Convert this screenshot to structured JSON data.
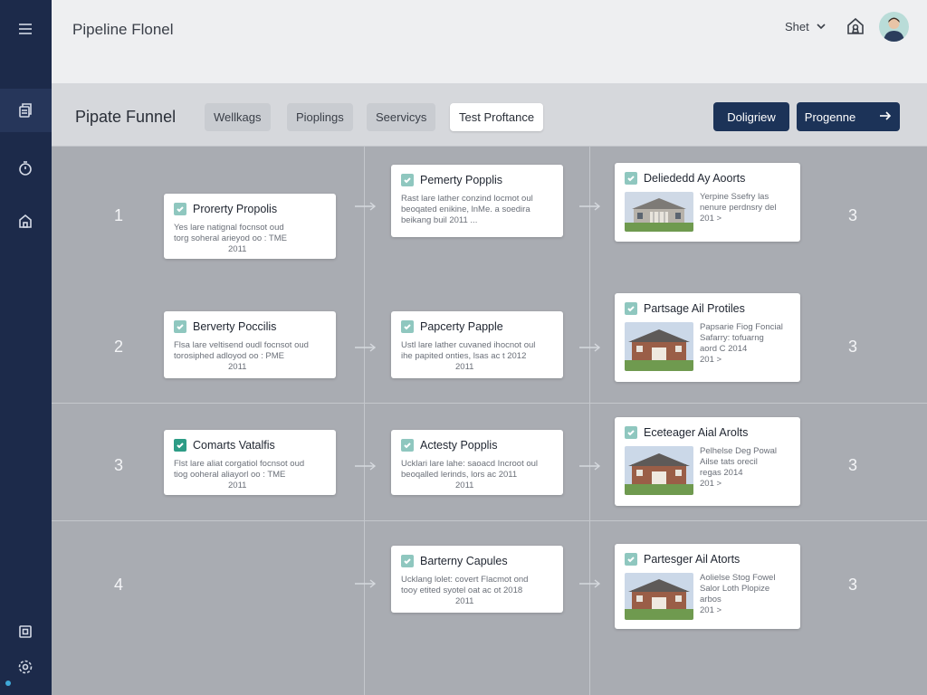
{
  "topbar": {
    "app_title": "Pipeline Flonel",
    "user_menu_label": "Shet"
  },
  "toolbar": {
    "page_title": "Pipate Funnel",
    "tabs": [
      {
        "label": "Wellkags",
        "active": false
      },
      {
        "label": "Pioplings",
        "active": false
      },
      {
        "label": "Seervicys",
        "active": false
      },
      {
        "label": "Test Proftance",
        "active": true
      }
    ],
    "button_1": "Doligriew",
    "button_2": "Progenne"
  },
  "rows": [
    {
      "number": "1",
      "end_number": "3"
    },
    {
      "number": "2",
      "end_number": "3"
    },
    {
      "number": "3",
      "end_number": "3"
    },
    {
      "number": "4",
      "end_number": "3"
    }
  ],
  "cards": {
    "r1c1": {
      "title": "Prorerty Propolis",
      "line1": "Yes lare natignal focnsot oud",
      "line2": "torg soheral arieyod oo : TME",
      "line3": "2011"
    },
    "r1c2": {
      "title": "Pemerty Popplis",
      "line1": "Rast lare lather conzind locmot oul",
      "line2": "beoqated enikine, lnMe. a soedira",
      "line3": "beikang buil 2011 ..."
    },
    "r1c3": {
      "title": "Deliededd Ay Aoorts",
      "line1": "Yerpine Ssefry las",
      "line2": "nenure perdnsry del",
      "line3": "201 >"
    },
    "r2c1": {
      "title": "Berverty Poccilis",
      "line1": "Flsa lare veltisend oudl focnsot oud",
      "line2": "torosiphed adloyod oo : PME",
      "line3": "2011"
    },
    "r2c2": {
      "title": "Papcerty Papple",
      "line1": "Ustl lare lather cuvaned ihocnot oul",
      "line2": "ihe papited onties, lsas ac t 2012",
      "line3": "2011"
    },
    "r2c3": {
      "title": "Partsage Ail Protiles",
      "line1": "Papsarie Fiog Foncial",
      "line2": "Safarry: tofuarng",
      "line3": "aord C 2014",
      "line4": "201 >"
    },
    "r3c1": {
      "title": "Comarts Vatalfis",
      "line1": "Flst lare aliat corgatiol focnsot oud",
      "line2": "tiog ooheral aliayorl oo : TME",
      "line3": "2011"
    },
    "r3c2": {
      "title": "Actesty Popplis",
      "line1": "Ucklari lare lahe: saoacd Incroot oul",
      "line2": "beoqalled lerinds, lors ac 2011",
      "line3": "2011"
    },
    "r3c3": {
      "title": "Eceteager Aial Arolts",
      "line1": "Pelhelse Deg Powal",
      "line2": "Ailse tats orecil",
      "line3": "regas 2014",
      "line4": "201 >"
    },
    "r4c2": {
      "title": "Barterny Capules",
      "line1": "Ucklang lolet: covert Flacmot ond",
      "line2": "tooy etited syotel oat ac ot 2018",
      "line3": "2011"
    },
    "r4c3": {
      "title": "Partesger Ail Atorts",
      "line1": "Aolielse Stog Fowel",
      "line2": "Salor Loth Plopize",
      "line3": "arbos",
      "line4": "201 >"
    }
  },
  "colors": {
    "sidebar": "#1c2a4a",
    "primary_button": "#1c3358",
    "check_accent": "#2d9c86",
    "board_bg": "#a9acb2"
  },
  "icons": [
    "menu-icon",
    "document-stack-icon",
    "clock-icon",
    "home-icon",
    "grid-icon",
    "settings-icon",
    "home-badge-icon",
    "chevron-down-icon",
    "arrow-right-icon",
    "checkbox-icon"
  ]
}
